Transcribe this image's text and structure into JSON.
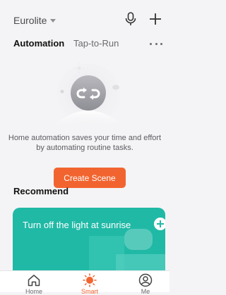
{
  "header": {
    "home_name": "Eurolite",
    "mic_icon": "microphone-icon",
    "add_icon": "plus-icon"
  },
  "tabs": [
    {
      "label": "Automation",
      "active": true
    },
    {
      "label": "Tap-to-Run",
      "active": false
    }
  ],
  "empty_state": {
    "illustration": "automation-sync-icon",
    "text": "Home automation saves your time and effort by automating routine tasks."
  },
  "create_button": {
    "label": "Create Scene"
  },
  "recommend": {
    "title": "Recommend",
    "cards": [
      {
        "title": "Turn off the light at sunrise"
      }
    ]
  },
  "bottom_nav": [
    {
      "label": "Home",
      "icon": "home-icon",
      "active": false
    },
    {
      "label": "Smart",
      "icon": "sun-icon",
      "active": true
    },
    {
      "label": "Me",
      "icon": "user-icon",
      "active": false
    }
  ],
  "colors": {
    "accent": "#f2642f",
    "card_teal": "#20b9a6",
    "background": "#f4f4f6"
  }
}
